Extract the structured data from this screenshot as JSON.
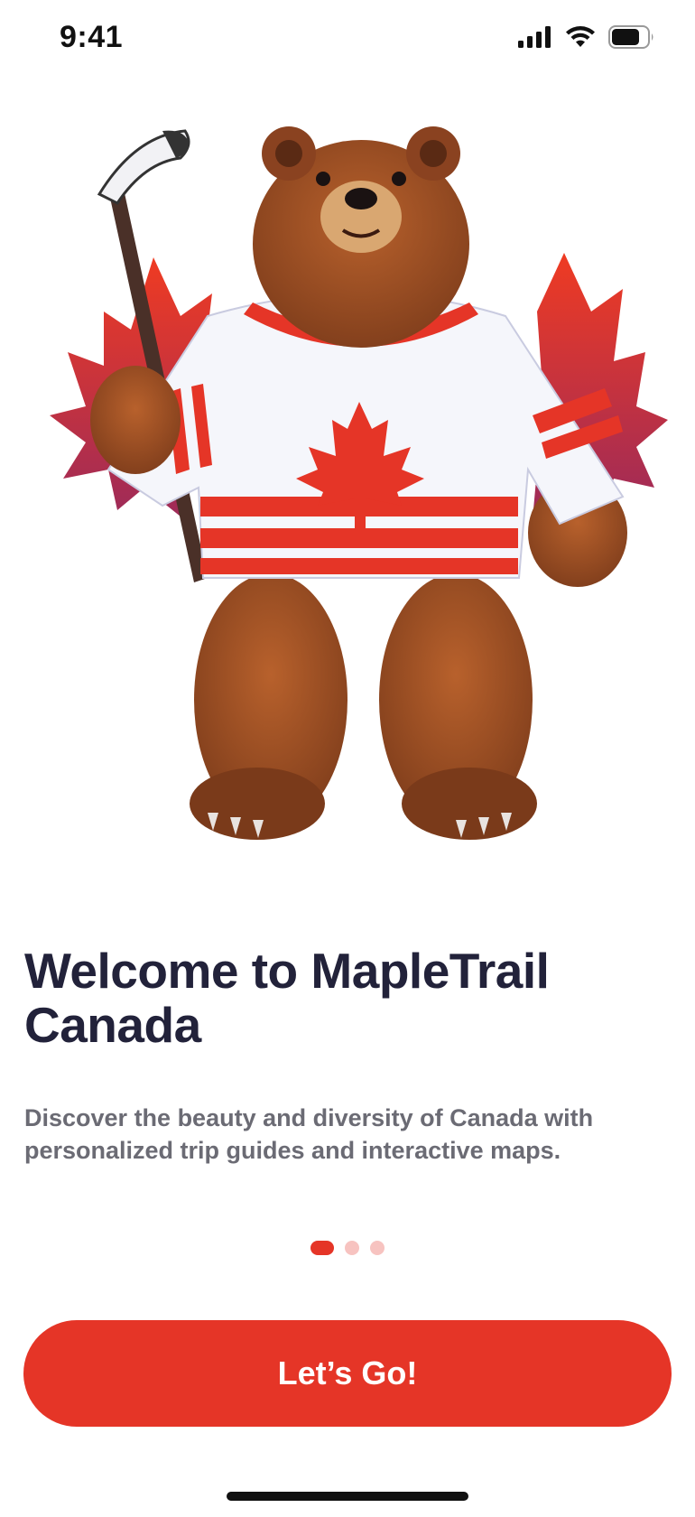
{
  "status_bar": {
    "time": "9:41",
    "icons": [
      "signal-icon",
      "wifi-icon",
      "battery-icon"
    ]
  },
  "hero": {
    "illustration": "bear-mascot-hockey-illustration",
    "jersey_color": "#e53527"
  },
  "onboarding": {
    "title": "Welcome to MapleTrail Canada",
    "description": "Discover the beauty and diversity of Canada with personalized trip guides and interactive maps.",
    "pager": {
      "current": 1,
      "total": 3
    },
    "cta_label": "Let’s Go!"
  },
  "colors": {
    "accent": "#e53527",
    "accent_light": "#f7c3c0",
    "title": "#22223a",
    "body": "#6b6b74"
  }
}
